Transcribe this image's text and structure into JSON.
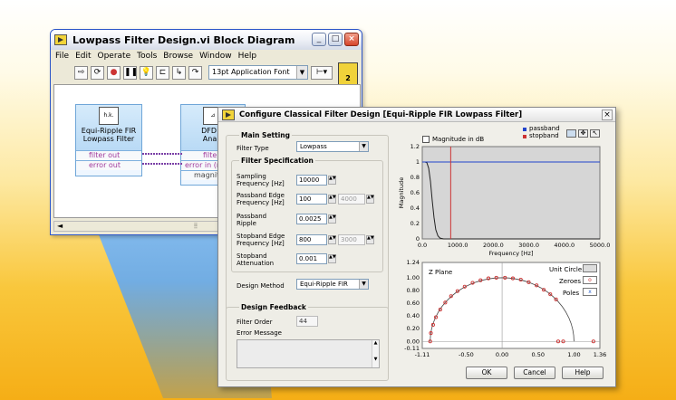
{
  "block_diagram": {
    "title": "Lowpass Filter Design.vi Block Diagram",
    "menu": [
      "File",
      "Edit",
      "Operate",
      "Tools",
      "Browse",
      "Window",
      "Help"
    ],
    "font_select": "13pt Application Font",
    "vi_number": "2",
    "node1": {
      "icon_text": "h.k.\nk.h",
      "title_line1": "Equi-Ripple FIR",
      "title_line2": "Lowpass Filter",
      "term1": "filter out",
      "term2": "error out"
    },
    "node2": {
      "title_line1": "DFD Fi",
      "title_line2": "Analy",
      "term1": "filter",
      "term2": "error in (n",
      "term3": "magnitu"
    }
  },
  "dialog": {
    "title": "Configure Classical Filter Design [Equi-Ripple FIR Lowpass Filter]",
    "main_setting": {
      "label": "Main Setting",
      "filter_type_label": "Filter Type",
      "filter_type_value": "Lowpass"
    },
    "filter_spec": {
      "label": "Filter Specification",
      "sampling_label1": "Sampling",
      "sampling_label2": "Frequency [Hz]",
      "sampling_value": "10000",
      "passband_edge_label1": "Passband Edge",
      "passband_edge_label2": "Frequency [Hz]",
      "passband_edge_value": "100",
      "passband_edge_alt": "4000",
      "passband_ripple_label1": "Passband",
      "passband_ripple_label2": "Ripple",
      "passband_ripple_value": "0.0025",
      "stopband_edge_label1": "Stopband Edge",
      "stopband_edge_label2": "Frequency [Hz]",
      "stopband_edge_value": "800",
      "stopband_edge_alt": "3000",
      "stopband_att_label1": "Stopband",
      "stopband_att_label2": "Attenuation",
      "stopband_att_value": "0.001"
    },
    "design_method_label": "Design Method",
    "design_method_value": "Equi-Ripple FIR",
    "feedback": {
      "label": "Design Feedback",
      "filter_order_label": "Filter Order",
      "filter_order_value": "44",
      "error_label": "Error Message"
    },
    "magnitude_in_db": "Magnitude in dB",
    "legend": {
      "passband": "passband",
      "stopband": "stopband"
    },
    "buttons": {
      "ok": "OK",
      "cancel": "Cancel",
      "help": "Help"
    },
    "zplane": {
      "title": "Z Plane",
      "unit_circle": "Unit Circle",
      "zeroes": "Zeroes",
      "poles": "Poles"
    }
  },
  "chart_data": [
    {
      "type": "line",
      "title": "",
      "xlabel": "Frequency [Hz]",
      "ylabel": "Magnitude",
      "xlim": [
        0,
        5000
      ],
      "ylim": [
        0,
        1.2
      ],
      "x_ticks": [
        "0.0",
        "1000.0",
        "2000.0",
        "3000.0",
        "4000.0",
        "5000.0"
      ],
      "y_ticks": [
        "0",
        "0.2",
        "0.4",
        "0.6",
        "0.8",
        "1",
        "1.2"
      ],
      "series": [
        {
          "name": "",
          "color": "#222222",
          "x": [
            0,
            80,
            130,
            180,
            230,
            280,
            330,
            380,
            440,
            500,
            600,
            800,
            1000,
            5000
          ],
          "y": [
            1,
            1,
            0.99,
            0.92,
            0.75,
            0.5,
            0.28,
            0.12,
            0.04,
            0.01,
            0,
            0,
            0,
            0
          ]
        },
        {
          "name": "passband",
          "color": "#2244cc",
          "x": [
            0,
            5000
          ],
          "y": [
            1,
            1
          ]
        },
        {
          "name": "stopband",
          "color": "#cc3333",
          "x": [
            800,
            800
          ],
          "y": [
            0,
            1.2
          ]
        }
      ]
    },
    {
      "type": "scatter",
      "title": "Z Plane",
      "xlim": [
        -1.11,
        1.36
      ],
      "ylim": [
        -0.11,
        1.24
      ],
      "x_ticks": [
        "-1.11",
        "-0.50",
        "0.00",
        "0.50",
        "1.00",
        "1.36"
      ],
      "y_ticks": [
        "-0.11",
        "0.00",
        "0.20",
        "0.40",
        "0.60",
        "0.80",
        "1.00",
        "1.24"
      ],
      "series": [
        {
          "name": "Zeroes",
          "color": "#cc3333",
          "x": [
            -1.0,
            -0.99,
            -0.96,
            -0.92,
            -0.86,
            -0.79,
            -0.71,
            -0.62,
            -0.52,
            -0.41,
            -0.3,
            -0.19,
            -0.08,
            0.04,
            0.15,
            0.26,
            0.37,
            0.48,
            0.58,
            0.67,
            0.75,
            0.78,
            0.85,
            1.27
          ],
          "y": [
            0.0,
            0.13,
            0.26,
            0.38,
            0.5,
            0.61,
            0.71,
            0.79,
            0.86,
            0.92,
            0.96,
            0.99,
            1.0,
            1.0,
            0.99,
            0.97,
            0.93,
            0.88,
            0.81,
            0.74,
            0.66,
            0.0,
            0.0,
            0.0
          ]
        }
      ]
    }
  ]
}
